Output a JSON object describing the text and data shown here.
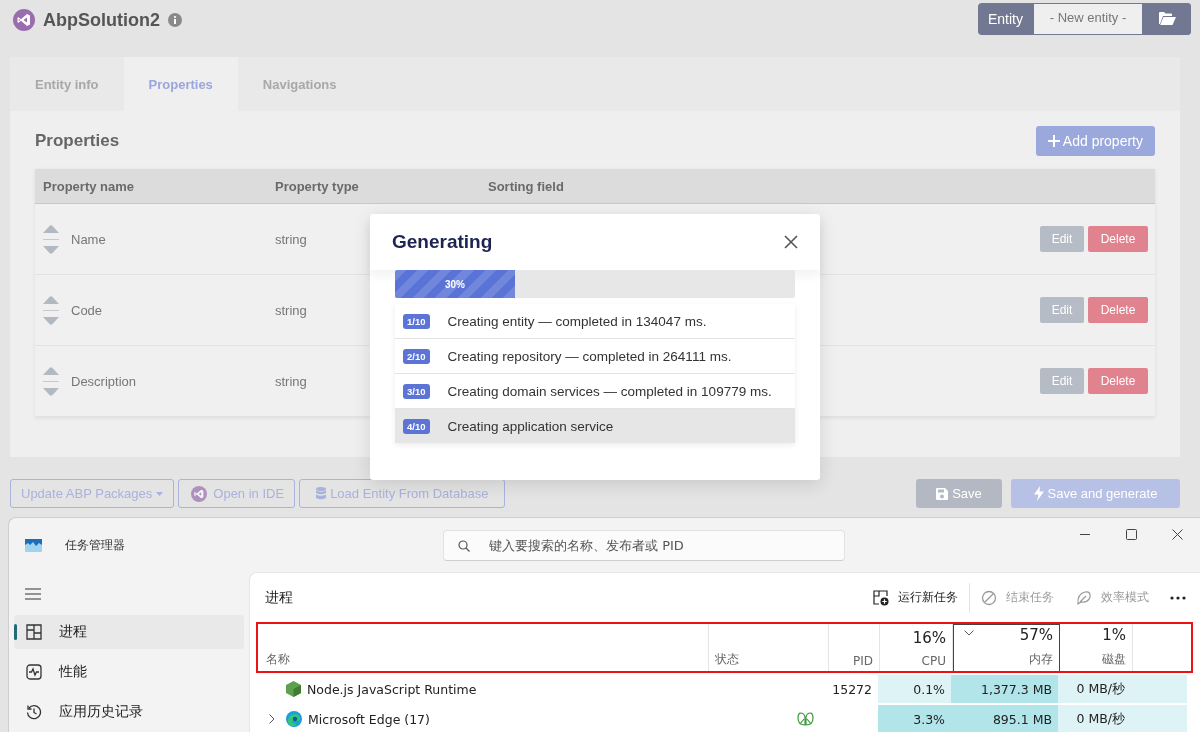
{
  "app": {
    "title": "AbpSolution2"
  },
  "entity_selector": {
    "label": "Entity",
    "value": "- New entity -"
  },
  "tabs": [
    {
      "label": "Entity info",
      "selected": false
    },
    {
      "label": "Properties",
      "selected": true
    },
    {
      "label": "Navigations",
      "selected": false
    }
  ],
  "properties": {
    "title": "Properties",
    "add_button": "Add property",
    "columns": [
      "Property name",
      "Property type",
      "Sorting field"
    ],
    "rows": [
      {
        "name": "Name",
        "type": "string",
        "edit": "Edit",
        "delete": "Delete"
      },
      {
        "name": "Code",
        "type": "string",
        "edit": "Edit",
        "delete": "Delete"
      },
      {
        "name": "Description",
        "type": "string",
        "edit": "Edit",
        "delete": "Delete"
      }
    ]
  },
  "actions": [
    {
      "label": "Update ABP Packages",
      "kind": "dropdown"
    },
    {
      "label": "Open in IDE",
      "kind": "ide"
    },
    {
      "label": "Load Entity From Database",
      "kind": "database"
    },
    {
      "label": "Save",
      "kind": "save"
    },
    {
      "label": "Save and generate",
      "kind": "generate"
    }
  ],
  "dialog": {
    "title": "Generating",
    "progress": {
      "level": 0.3,
      "label": "30%"
    },
    "steps": [
      {
        "badge": "1/10",
        "text": "Creating entity — completed in 134047 ms.",
        "current": false
      },
      {
        "badge": "2/10",
        "text": "Creating repository — completed in 264111 ms.",
        "current": false
      },
      {
        "badge": "3/10",
        "text": "Creating domain services — completed in 109779 ms.",
        "current": false
      },
      {
        "badge": "4/10",
        "text": "Creating application service",
        "current": true
      }
    ]
  },
  "task_manager": {
    "title": "任务管理器",
    "search": {
      "placeholder": "键入要搜索的名称、发布者或 PID"
    },
    "nav": [
      {
        "label": "进程",
        "selected": true
      },
      {
        "label": "性能",
        "selected": false
      },
      {
        "label": "应用历史记录",
        "selected": false
      }
    ],
    "page_title": "进程",
    "toolbar": [
      {
        "label": "运行新任务",
        "disabled": false
      },
      {
        "label": "结束任务",
        "disabled": true
      },
      {
        "label": "效率模式",
        "disabled": true
      }
    ],
    "header_highlighted": true,
    "columns": [
      {
        "label": "名称",
        "sorted": false
      },
      {
        "label": "状态",
        "sorted": false
      },
      {
        "label": "PID",
        "sorted": false
      },
      {
        "label": "CPU",
        "summary": "16%",
        "sorted": false
      },
      {
        "label": "内存",
        "summary": "57%",
        "sorted": true
      },
      {
        "label": "磁盘",
        "summary": "1%",
        "sorted": false
      }
    ],
    "processes": [
      {
        "name": "Node.js JavaScript Runtime",
        "expandable": false,
        "efficiency_mode": false,
        "pid": "15272",
        "cpu": {
          "text": "0.1%",
          "color": "#def3f6"
        },
        "memory": {
          "text": "1,377.3 MB",
          "color": "#b1e5ea"
        },
        "disk": {
          "text": "0 MB/秒",
          "color": "#def3f6"
        }
      },
      {
        "name": "Microsoft Edge (17)",
        "expandable": true,
        "efficiency_mode": true,
        "cpu": {
          "text": "3.3%",
          "color": "#b1e5ea"
        },
        "memory": {
          "text": "895.1 MB",
          "color": "#b1e5ea"
        },
        "disk": {
          "text": "0 MB/秒",
          "color": "#def3f6"
        }
      }
    ]
  }
}
